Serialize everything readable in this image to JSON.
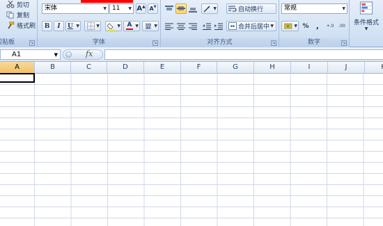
{
  "clipboard": {
    "cut_label": "剪切",
    "copy_label": "复制",
    "format_painter_label": "格式刷",
    "group_label": "剪贴板"
  },
  "font": {
    "font_name": "宋体",
    "font_size": "11",
    "grow_label": "A",
    "shrink_label": "A",
    "bold_label": "B",
    "italic_label": "I",
    "underline_label": "U",
    "font_color_label": "A",
    "phonetic_label": "變",
    "group_label": "字体"
  },
  "alignment": {
    "wrap_text_label": "自动换行",
    "merge_center_label": "合并后居中",
    "group_label": "对齐方式"
  },
  "number": {
    "format_value": "常规",
    "percent_label": "%",
    "comma_label": ",",
    "increase_decimal_label": "+.0",
    "decrease_decimal_label": ".00",
    "group_label": "数字"
  },
  "styles": {
    "conditional_formatting_label": "条件格式"
  },
  "formula_bar": {
    "name_box_value": "A1",
    "fx_label": "fx"
  },
  "grid": {
    "columns": [
      "A",
      "B",
      "C",
      "D",
      "E",
      "F",
      "G",
      "H",
      "I",
      "J",
      "K"
    ],
    "selected_column": "A",
    "selected_cell": "A1"
  },
  "colors": {
    "accent_highlight": "#ffd36b",
    "fill_color": "#ffff00",
    "font_color": "#ff0000",
    "title_red": "#ff0000"
  }
}
